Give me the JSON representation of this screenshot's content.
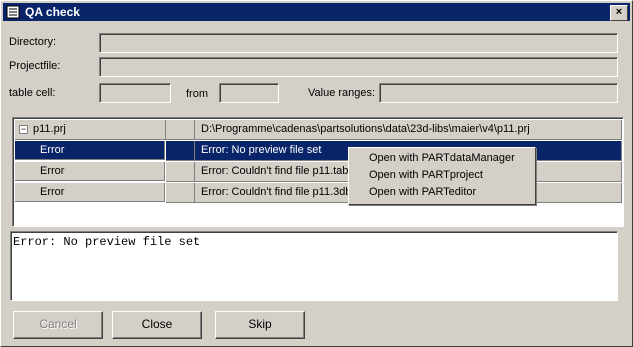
{
  "window": {
    "title": "QA check",
    "close_glyph": "×"
  },
  "form": {
    "directory_label": "Directory:",
    "directory_value": "",
    "projectfile_label": "Projectfile:",
    "projectfile_value": "",
    "tablecell_label": "table cell:",
    "tablecell_value": "",
    "from_label": "from",
    "from_value": "",
    "value_ranges_label": "Value ranges:",
    "value_ranges_value": ""
  },
  "tree": {
    "root": {
      "expander": "−",
      "name": "p11.prj",
      "path": "D:\\Programme\\cadenas\\partsolutions\\data\\23d-libs\\maier\\v4\\p11.prj"
    },
    "rows": [
      {
        "type": "Error",
        "message": "Error: No preview file set",
        "selected": true
      },
      {
        "type": "Error",
        "message": "Error: Couldn't find file p11.tab."
      },
      {
        "type": "Error",
        "message": "Error: Couldn't find file p11.3db."
      }
    ]
  },
  "message_text": "Error: No preview file set",
  "context_menu": {
    "items": [
      "Open with PARTdataManager",
      "Open with PARTproject",
      "Open with PARTeditor"
    ]
  },
  "buttons": {
    "cancel": "Cancel",
    "close": "Close",
    "skip": "Skip"
  },
  "colors": {
    "selection": "#0a246a",
    "face": "#d4d0c8"
  }
}
